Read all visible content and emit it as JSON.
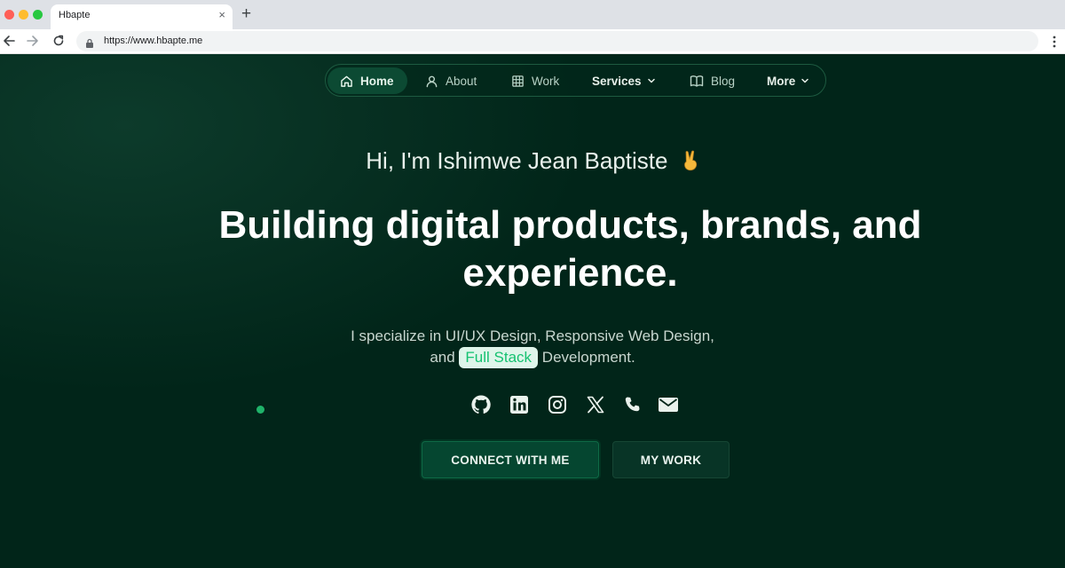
{
  "browser": {
    "tab_title": "Hbapte",
    "tab_close": "×",
    "new_tab": "+",
    "url": "https://www.hbapte.me"
  },
  "nav": {
    "items": [
      {
        "label": "Home",
        "icon": "home-icon",
        "active": true
      },
      {
        "label": "About",
        "icon": "user-icon"
      },
      {
        "label": "Work",
        "icon": "grid-icon"
      },
      {
        "label": "Services",
        "icon": "chevron-down-icon",
        "has_dropdown": true
      },
      {
        "label": "Blog",
        "icon": "book-open-icon"
      },
      {
        "label": "More",
        "icon": "chevron-down-icon",
        "has_dropdown": true
      }
    ]
  },
  "hero": {
    "greeting": "Hi, I'm Ishimwe Jean Baptiste",
    "greeting_icon": "victory-hand-icon",
    "headline": "Building digital products, brands, and experience.",
    "sub_line1": "I specialize in UI/UX Design, Responsive Web Design,",
    "sub_and": "and",
    "sub_highlight": "Full Stack",
    "sub_end": "Development."
  },
  "socials": [
    "github-icon",
    "linkedin-icon",
    "instagram-icon",
    "x-icon",
    "phone-icon",
    "mail-icon"
  ],
  "buttons": {
    "connect": "CONNECT WITH ME",
    "work": "MY WORK"
  },
  "colors": {
    "background": "#012519",
    "accent": "#16c271",
    "nav_active": "#0c4a33",
    "highlight_bg": "#dff5ea"
  }
}
